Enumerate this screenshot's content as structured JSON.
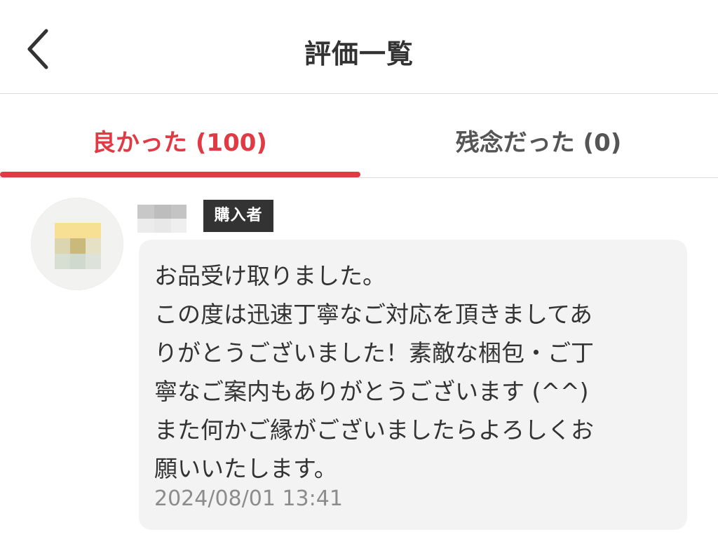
{
  "header": {
    "title": "評価一覧",
    "back_icon": "chevron-left-icon"
  },
  "tabs": [
    {
      "label": "良かった (100)",
      "active": true
    },
    {
      "label": "残念だった (0)",
      "active": false
    }
  ],
  "colors": {
    "accent": "#e03a45",
    "badge_bg": "#333333",
    "bubble_bg": "#f3f3f3",
    "timestamp": "#8c8c8c"
  },
  "review": {
    "badge": "購入者",
    "message": "お品受け取りました。\nこの度は迅速丁寧なご対応を頂きましてありがとうございました！素敵な梱包・ご丁寧なご案内もありがとうございます (^^)\nまた何かご縁がございましたらよろしくお願いいたします。",
    "message_lines": [
      "お品受け取りました。",
      "この度は迅速丁寧なご対応を頂きましてあ",
      "りがとうございました！素敵な梱包・ご丁",
      "寧なご案内もありがとうございます (^^)",
      "また何かご縁がございましたらよろしくお",
      "願いいたします。"
    ],
    "timestamp": "2024/08/01 13:41"
  }
}
